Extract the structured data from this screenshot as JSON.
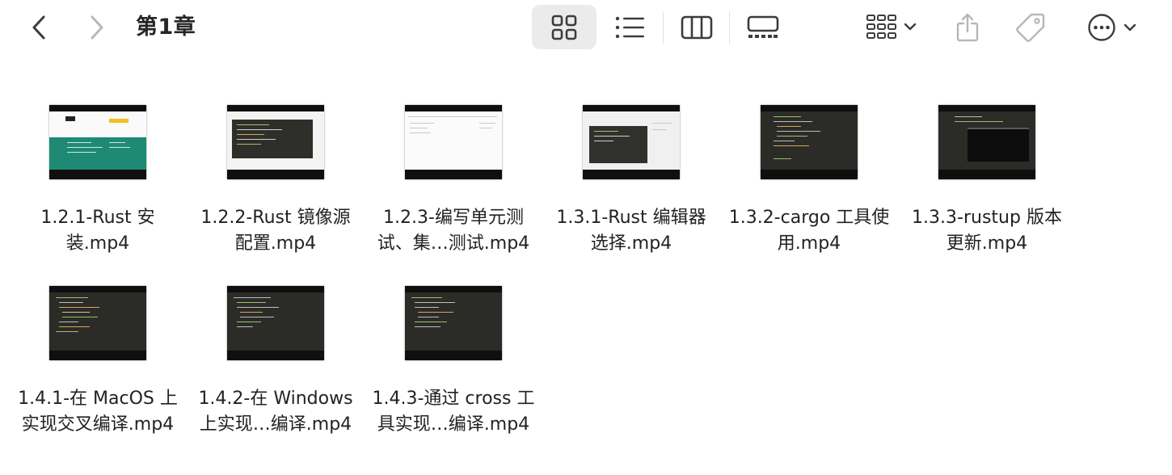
{
  "toolbar": {
    "back_icon": "chevron-left-icon",
    "forward_icon": "chevron-right-icon",
    "title": "第1章",
    "view_buttons": [
      "icon-view",
      "list-view",
      "column-view",
      "gallery-view"
    ],
    "group_icon": "group-by-icon",
    "share_icon": "share-icon",
    "tag_icon": "tag-icon",
    "more_icon": "ellipsis-circle-icon"
  },
  "files": [
    {
      "line1": "1.2.1-Rust 安",
      "line2": "装.mp4",
      "thumb": "web"
    },
    {
      "line1": "1.2.2-Rust 镜像源",
      "line2": "配置.mp4",
      "thumb": "dark-editor-light"
    },
    {
      "line1": "1.2.3-编写单元测",
      "line2": "试、集…测试.mp4",
      "thumb": "light"
    },
    {
      "line1": "1.3.1-Rust 编辑器",
      "line2": "选择.mp4",
      "thumb": "dark-dialog-light"
    },
    {
      "line1": "1.3.2-cargo 工具使",
      "line2": "用.mp4",
      "thumb": "dark"
    },
    {
      "line1": "1.3.3-rustup 版本",
      "line2": "更新.mp4",
      "thumb": "dark-terminal"
    },
    {
      "line1": "1.4.1-在 MacOS 上",
      "line2": "实现交叉编译.mp4",
      "thumb": "dark"
    },
    {
      "line1": "1.4.2-在 Windows",
      "line2": "上实现…编译.mp4",
      "thumb": "dark"
    },
    {
      "line1": "1.4.3-通过 cross 工",
      "line2": "具实现…编译.mp4",
      "thumb": "dark"
    }
  ],
  "colors": {
    "accent_green": "#1e8a74",
    "accent_yellow": "#f2c01c",
    "icon_gray": "#3c3c3c",
    "icon_light": "#b7b7b7"
  }
}
